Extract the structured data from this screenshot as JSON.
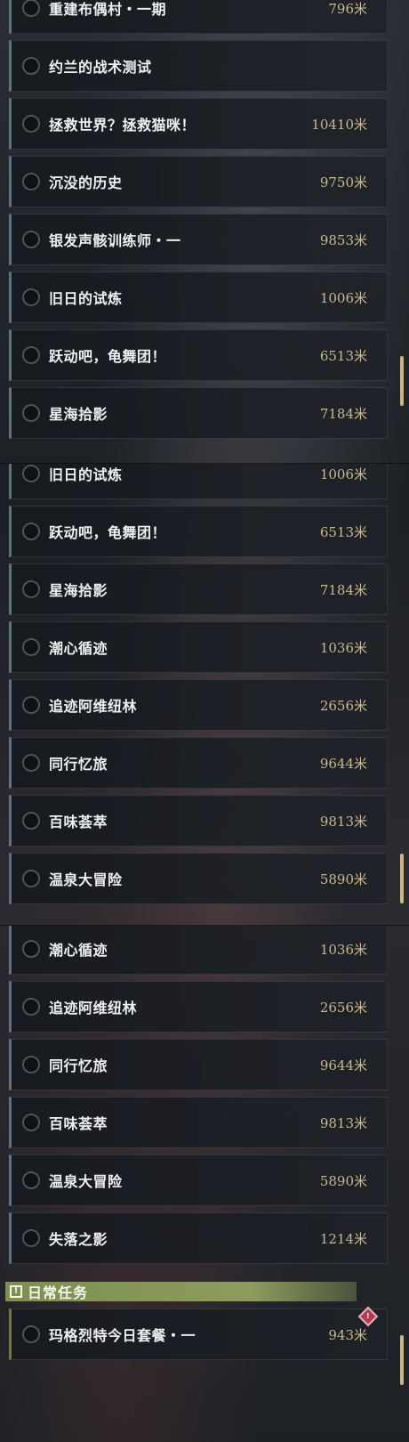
{
  "colors": {
    "distance_text": "#cbb98a",
    "daily_header": "#8c9c5c",
    "row_accent": "#5d7384",
    "scrollbar": "#c8b780",
    "alert_badge": "#b23b52"
  },
  "panel1": {
    "scrollbar_position": 0.78,
    "tasks": [
      {
        "name": "重建布偶村・一期",
        "distance": "796米"
      },
      {
        "name": "约兰的战术测试",
        "distance": ""
      },
      {
        "name": "拯救世界？拯救猫咪！",
        "distance": "10410米"
      },
      {
        "name": "沉没的历史",
        "distance": "9750米"
      },
      {
        "name": "银发声骸训练师・一",
        "distance": "9853米"
      },
      {
        "name": "旧日的试炼",
        "distance": "1006米"
      },
      {
        "name": "跃动吧，龟舞团！",
        "distance": "6513米"
      },
      {
        "name": "星海拾影",
        "distance": "7184米"
      }
    ]
  },
  "panel2": {
    "scrollbar_position": 0.9,
    "tasks": [
      {
        "name": "旧日的试炼",
        "distance": "1006米"
      },
      {
        "name": "跃动吧，龟舞团！",
        "distance": "6513米"
      },
      {
        "name": "星海拾影",
        "distance": "7184米"
      },
      {
        "name": "潮心循迹",
        "distance": "1036米"
      },
      {
        "name": "追迹阿维纽林",
        "distance": "2656米"
      },
      {
        "name": "同行忆旅",
        "distance": "9644米"
      },
      {
        "name": "百味荟萃",
        "distance": "9813米"
      },
      {
        "name": "温泉大冒险",
        "distance": "5890米"
      }
    ]
  },
  "panel3": {
    "tasks": [
      {
        "name": "潮心循迹",
        "distance": "1036米"
      },
      {
        "name": "追迹阿维纽林",
        "distance": "2656米"
      },
      {
        "name": "同行忆旅",
        "distance": "9644米"
      },
      {
        "name": "百味荟萃",
        "distance": "9813米"
      },
      {
        "name": "温泉大冒险",
        "distance": "5890米"
      },
      {
        "name": "失落之影",
        "distance": "1214米"
      }
    ],
    "daily_section": {
      "icon": "exclamation-box-icon",
      "icon_glyph": "!",
      "title": "日常任务",
      "badge_icon": "alert-diamond-icon",
      "badge_glyph": "!",
      "tasks": [
        {
          "name": "玛格烈特今日套餐・一",
          "distance": "943米"
        }
      ]
    }
  }
}
